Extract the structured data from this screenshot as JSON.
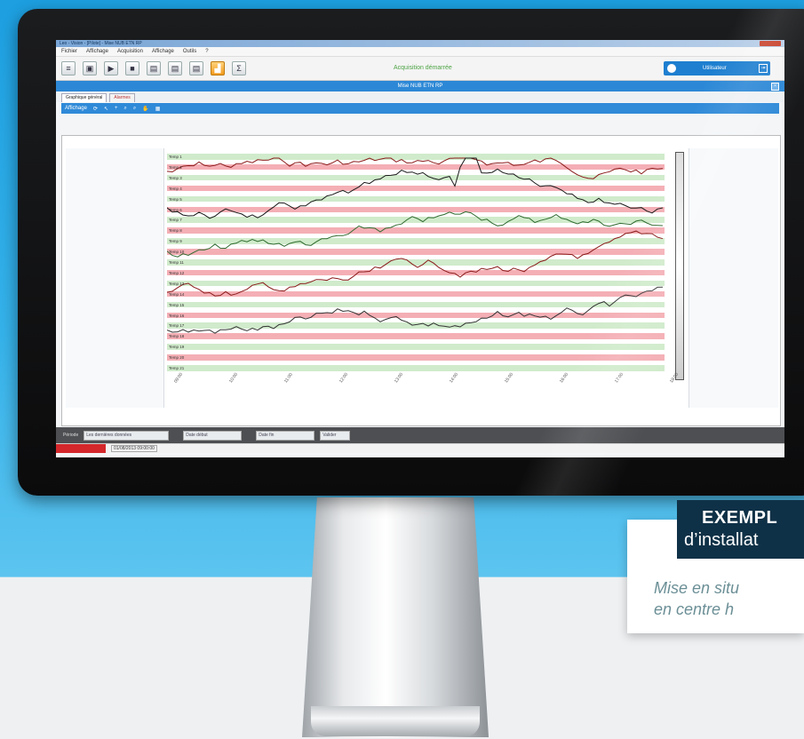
{
  "window": {
    "title": "Leo - Vision - [Pilote] - Mise NUB ETN RP"
  },
  "menu": [
    "Fichier",
    "Affichage",
    "Acquisition",
    "Affichage",
    "Outils",
    "?"
  ],
  "toolbar": {
    "status": "Acquisition démarrée",
    "icons": [
      "list-icon",
      "save-icon",
      "play-icon",
      "stop-icon",
      "page-icon",
      "page-icon",
      "page-icon",
      "chart-icon",
      "sigma-icon"
    ],
    "user_label": "Utilisateur"
  },
  "document": {
    "title": "Mise NUB ETN RP",
    "close": "×"
  },
  "tabs": [
    {
      "label": "Graphique général"
    },
    {
      "label": "Alarmes"
    }
  ],
  "plot_toolbar": {
    "label": "Affichage"
  },
  "plot": {
    "trace_labels": [
      "Temp 1",
      "Temp 2",
      "Temp 3",
      "Temp 4",
      "Temp 5",
      "Temp 6",
      "Temp 7",
      "Temp 8",
      "Temp 9",
      "Temp 10",
      "Temp 11",
      "Temp 12",
      "Temp 13",
      "Temp 14",
      "Temp 15",
      "Temp 16",
      "Temp 17",
      "Temp 18",
      "Temp 19",
      "Temp 20",
      "Temp 21"
    ],
    "x_ticks": [
      "09:00",
      "10:00",
      "11:00",
      "12:00",
      "13:00",
      "14:00",
      "15:00",
      "16:00",
      "17:00",
      "18:00"
    ]
  },
  "bottom": {
    "period_label": "Période",
    "period_value": "Les dernières données",
    "from_value": "Date début",
    "to_value": "Date fin",
    "ok": "Valider"
  },
  "statusbar": {
    "text": "01/08/2013 09:00:00"
  },
  "callout": {
    "title": "EXEMPL",
    "subtitle": "d’installat",
    "desc_line1": "Mise en situ",
    "desc_line2": "en centre h"
  }
}
